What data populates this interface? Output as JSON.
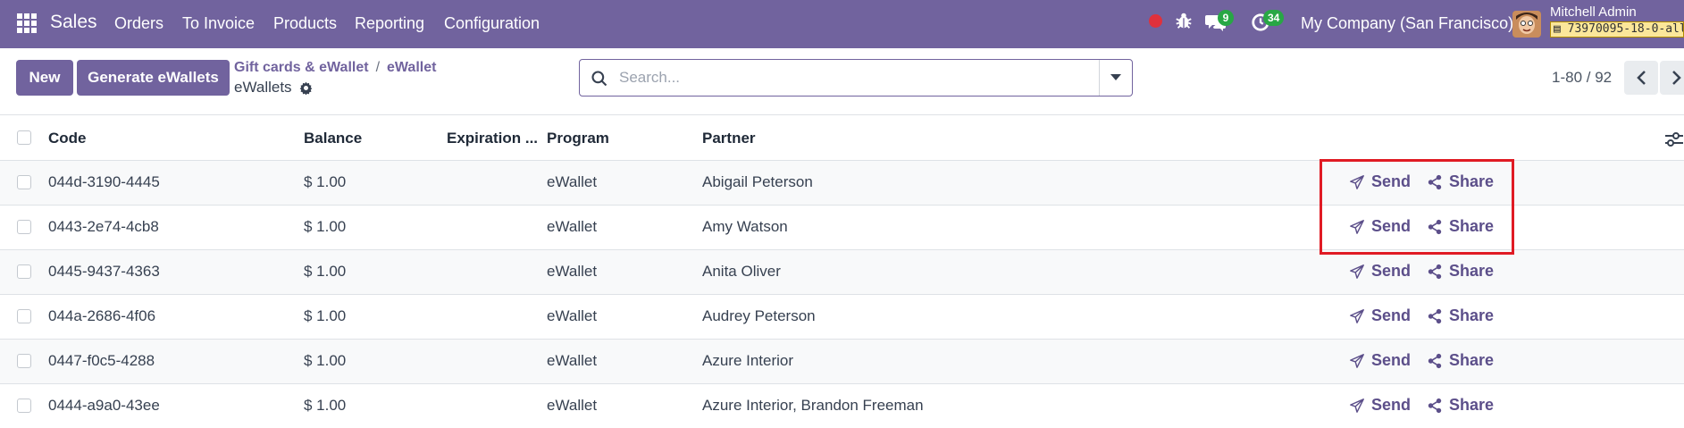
{
  "navbar": {
    "app_name": "Sales",
    "menu": [
      "Orders",
      "To Invoice",
      "Products",
      "Reporting",
      "Configuration"
    ],
    "messages_badge": "9",
    "activities_badge": "34",
    "company": "My Company (San Francisco)",
    "user_name": "Mitchell Admin",
    "db_name": "73970095-18-0-all"
  },
  "control_panel": {
    "new_label": "New",
    "generate_label": "Generate eWallets",
    "breadcrumb_parent": "Gift cards & eWallet",
    "breadcrumb_sep": "/",
    "breadcrumb_current": "eWallet",
    "page_title": "eWallets",
    "search_placeholder": "Search...",
    "pager": "1-80 / 92"
  },
  "table": {
    "columns": {
      "code": "Code",
      "balance": "Balance",
      "expiration": "Expiration ...",
      "program": "Program",
      "partner": "Partner"
    },
    "send_label": "Send",
    "share_label": "Share",
    "rows": [
      {
        "code": "044d-3190-4445",
        "balance": "$ 1.00",
        "program": "eWallet",
        "partner": "Abigail Peterson"
      },
      {
        "code": "0443-2e74-4cb8",
        "balance": "$ 1.00",
        "program": "eWallet",
        "partner": "Amy Watson"
      },
      {
        "code": "0445-9437-4363",
        "balance": "$ 1.00",
        "program": "eWallet",
        "partner": "Anita Oliver"
      },
      {
        "code": "044a-2686-4f06",
        "balance": "$ 1.00",
        "program": "eWallet",
        "partner": "Audrey Peterson"
      },
      {
        "code": "0447-f0c5-4288",
        "balance": "$ 1.00",
        "program": "eWallet",
        "partner": "Azure Interior"
      },
      {
        "code": "0444-a9a0-43ee",
        "balance": "$ 1.00",
        "program": "eWallet",
        "partner": "Azure Interior, Brandon Freeman"
      }
    ]
  },
  "colors": {
    "brand": "#71639e",
    "highlight": "#e01b24",
    "badge": "#28a745",
    "recording": "#e0313c"
  }
}
